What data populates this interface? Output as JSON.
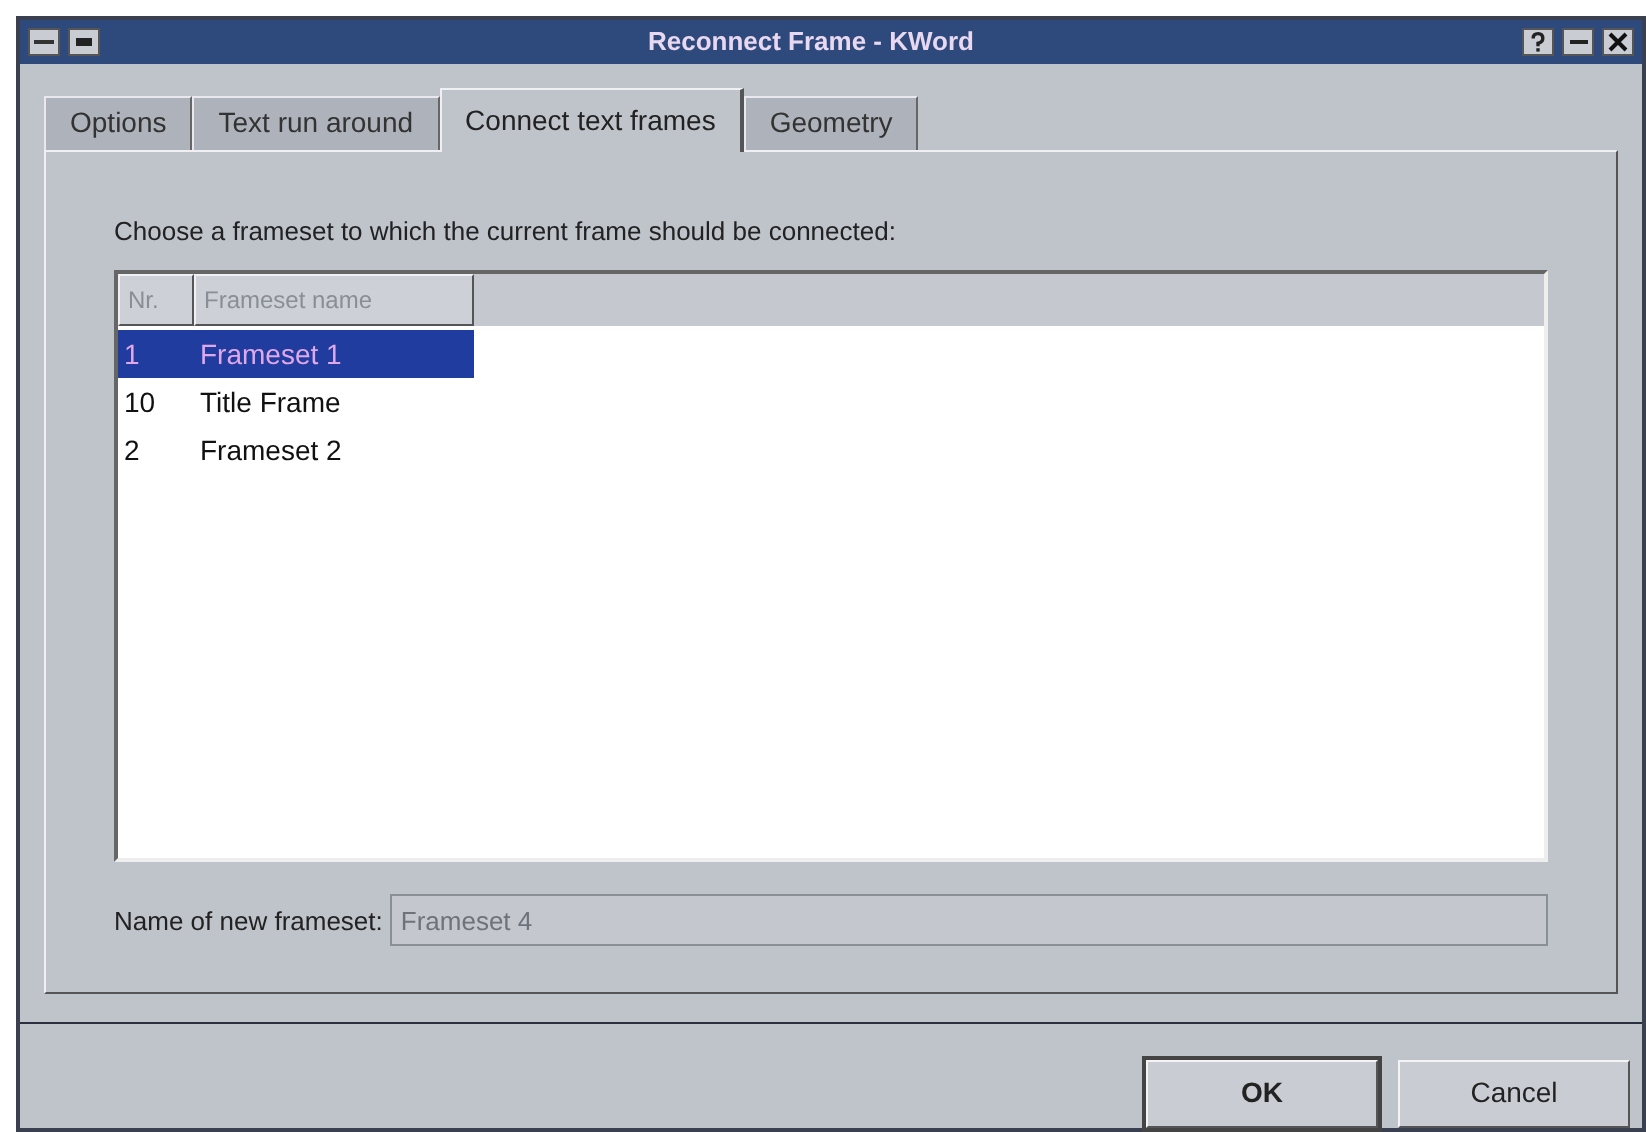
{
  "window": {
    "title": "Reconnect Frame - KWord"
  },
  "tabs": [
    {
      "label": "Options",
      "selected": false
    },
    {
      "label": "Text run around",
      "selected": false
    },
    {
      "label": "Connect text frames",
      "selected": true
    },
    {
      "label": "Geometry",
      "selected": false
    }
  ],
  "instruction": "Choose a frameset to which the current frame should be connected:",
  "table": {
    "columns": [
      "Nr.",
      "Frameset name"
    ],
    "rows": [
      {
        "cells": [
          "1",
          "Frameset 1"
        ],
        "selected": true
      },
      {
        "cells": [
          "10",
          "Title Frame"
        ],
        "selected": false
      },
      {
        "cells": [
          "2",
          "Frameset 2"
        ],
        "selected": false
      }
    ]
  },
  "new_frameset": {
    "label": "Name of new frameset:",
    "value": "Frameset 4",
    "disabled": true
  },
  "buttons": [
    {
      "label": "OK",
      "default": true
    },
    {
      "label": "Cancel",
      "default": false
    }
  ]
}
